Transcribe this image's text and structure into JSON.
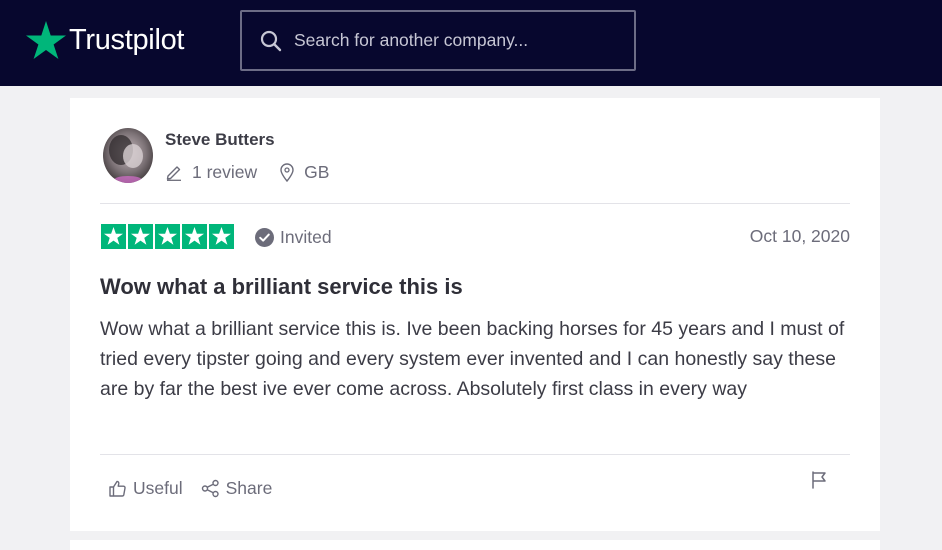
{
  "header": {
    "brand": "Trustpilot",
    "search_placeholder": "Search for another company..."
  },
  "review": {
    "reviewer_name": "Steve Butters",
    "review_count": "1 review",
    "country": "GB",
    "rating": 5,
    "rating_max": 5,
    "invited_label": "Invited",
    "date": "Oct 10, 2020",
    "title": "Wow what a brilliant service this is",
    "text": "Wow what a brilliant service this is. Ive been backing horses for 45 years and I must of tried every tipster going and every system ever invented and I can honestly say these are by far the best ive ever come across. Absolutely first class in every way",
    "useful_label": "Useful",
    "share_label": "Share"
  },
  "colors": {
    "header_bg": "#07072e",
    "brand_star": "#00b67a",
    "page_bg": "#f1f1f3"
  },
  "icons": [
    "star-logo-icon",
    "search-icon",
    "pencil-icon",
    "location-pin-icon",
    "star-icon",
    "check-circle-icon",
    "thumbs-up-icon",
    "share-icon",
    "flag-icon"
  ]
}
